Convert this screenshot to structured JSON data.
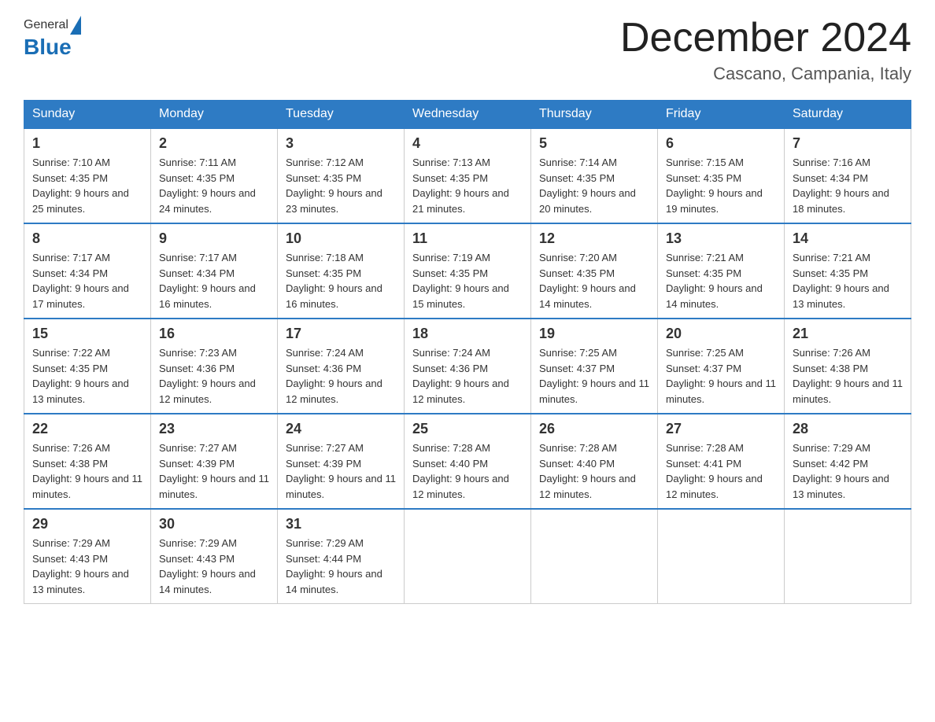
{
  "header": {
    "logo_general": "General",
    "logo_blue": "Blue",
    "month_title": "December 2024",
    "subtitle": "Cascano, Campania, Italy"
  },
  "weekdays": [
    "Sunday",
    "Monday",
    "Tuesday",
    "Wednesday",
    "Thursday",
    "Friday",
    "Saturday"
  ],
  "weeks": [
    [
      {
        "day": "1",
        "sunrise": "Sunrise: 7:10 AM",
        "sunset": "Sunset: 4:35 PM",
        "daylight": "Daylight: 9 hours and 25 minutes."
      },
      {
        "day": "2",
        "sunrise": "Sunrise: 7:11 AM",
        "sunset": "Sunset: 4:35 PM",
        "daylight": "Daylight: 9 hours and 24 minutes."
      },
      {
        "day": "3",
        "sunrise": "Sunrise: 7:12 AM",
        "sunset": "Sunset: 4:35 PM",
        "daylight": "Daylight: 9 hours and 23 minutes."
      },
      {
        "day": "4",
        "sunrise": "Sunrise: 7:13 AM",
        "sunset": "Sunset: 4:35 PM",
        "daylight": "Daylight: 9 hours and 21 minutes."
      },
      {
        "day": "5",
        "sunrise": "Sunrise: 7:14 AM",
        "sunset": "Sunset: 4:35 PM",
        "daylight": "Daylight: 9 hours and 20 minutes."
      },
      {
        "day": "6",
        "sunrise": "Sunrise: 7:15 AM",
        "sunset": "Sunset: 4:35 PM",
        "daylight": "Daylight: 9 hours and 19 minutes."
      },
      {
        "day": "7",
        "sunrise": "Sunrise: 7:16 AM",
        "sunset": "Sunset: 4:34 PM",
        "daylight": "Daylight: 9 hours and 18 minutes."
      }
    ],
    [
      {
        "day": "8",
        "sunrise": "Sunrise: 7:17 AM",
        "sunset": "Sunset: 4:34 PM",
        "daylight": "Daylight: 9 hours and 17 minutes."
      },
      {
        "day": "9",
        "sunrise": "Sunrise: 7:17 AM",
        "sunset": "Sunset: 4:34 PM",
        "daylight": "Daylight: 9 hours and 16 minutes."
      },
      {
        "day": "10",
        "sunrise": "Sunrise: 7:18 AM",
        "sunset": "Sunset: 4:35 PM",
        "daylight": "Daylight: 9 hours and 16 minutes."
      },
      {
        "day": "11",
        "sunrise": "Sunrise: 7:19 AM",
        "sunset": "Sunset: 4:35 PM",
        "daylight": "Daylight: 9 hours and 15 minutes."
      },
      {
        "day": "12",
        "sunrise": "Sunrise: 7:20 AM",
        "sunset": "Sunset: 4:35 PM",
        "daylight": "Daylight: 9 hours and 14 minutes."
      },
      {
        "day": "13",
        "sunrise": "Sunrise: 7:21 AM",
        "sunset": "Sunset: 4:35 PM",
        "daylight": "Daylight: 9 hours and 14 minutes."
      },
      {
        "day": "14",
        "sunrise": "Sunrise: 7:21 AM",
        "sunset": "Sunset: 4:35 PM",
        "daylight": "Daylight: 9 hours and 13 minutes."
      }
    ],
    [
      {
        "day": "15",
        "sunrise": "Sunrise: 7:22 AM",
        "sunset": "Sunset: 4:35 PM",
        "daylight": "Daylight: 9 hours and 13 minutes."
      },
      {
        "day": "16",
        "sunrise": "Sunrise: 7:23 AM",
        "sunset": "Sunset: 4:36 PM",
        "daylight": "Daylight: 9 hours and 12 minutes."
      },
      {
        "day": "17",
        "sunrise": "Sunrise: 7:24 AM",
        "sunset": "Sunset: 4:36 PM",
        "daylight": "Daylight: 9 hours and 12 minutes."
      },
      {
        "day": "18",
        "sunrise": "Sunrise: 7:24 AM",
        "sunset": "Sunset: 4:36 PM",
        "daylight": "Daylight: 9 hours and 12 minutes."
      },
      {
        "day": "19",
        "sunrise": "Sunrise: 7:25 AM",
        "sunset": "Sunset: 4:37 PM",
        "daylight": "Daylight: 9 hours and 11 minutes."
      },
      {
        "day": "20",
        "sunrise": "Sunrise: 7:25 AM",
        "sunset": "Sunset: 4:37 PM",
        "daylight": "Daylight: 9 hours and 11 minutes."
      },
      {
        "day": "21",
        "sunrise": "Sunrise: 7:26 AM",
        "sunset": "Sunset: 4:38 PM",
        "daylight": "Daylight: 9 hours and 11 minutes."
      }
    ],
    [
      {
        "day": "22",
        "sunrise": "Sunrise: 7:26 AM",
        "sunset": "Sunset: 4:38 PM",
        "daylight": "Daylight: 9 hours and 11 minutes."
      },
      {
        "day": "23",
        "sunrise": "Sunrise: 7:27 AM",
        "sunset": "Sunset: 4:39 PM",
        "daylight": "Daylight: 9 hours and 11 minutes."
      },
      {
        "day": "24",
        "sunrise": "Sunrise: 7:27 AM",
        "sunset": "Sunset: 4:39 PM",
        "daylight": "Daylight: 9 hours and 11 minutes."
      },
      {
        "day": "25",
        "sunrise": "Sunrise: 7:28 AM",
        "sunset": "Sunset: 4:40 PM",
        "daylight": "Daylight: 9 hours and 12 minutes."
      },
      {
        "day": "26",
        "sunrise": "Sunrise: 7:28 AM",
        "sunset": "Sunset: 4:40 PM",
        "daylight": "Daylight: 9 hours and 12 minutes."
      },
      {
        "day": "27",
        "sunrise": "Sunrise: 7:28 AM",
        "sunset": "Sunset: 4:41 PM",
        "daylight": "Daylight: 9 hours and 12 minutes."
      },
      {
        "day": "28",
        "sunrise": "Sunrise: 7:29 AM",
        "sunset": "Sunset: 4:42 PM",
        "daylight": "Daylight: 9 hours and 13 minutes."
      }
    ],
    [
      {
        "day": "29",
        "sunrise": "Sunrise: 7:29 AM",
        "sunset": "Sunset: 4:43 PM",
        "daylight": "Daylight: 9 hours and 13 minutes."
      },
      {
        "day": "30",
        "sunrise": "Sunrise: 7:29 AM",
        "sunset": "Sunset: 4:43 PM",
        "daylight": "Daylight: 9 hours and 14 minutes."
      },
      {
        "day": "31",
        "sunrise": "Sunrise: 7:29 AM",
        "sunset": "Sunset: 4:44 PM",
        "daylight": "Daylight: 9 hours and 14 minutes."
      },
      null,
      null,
      null,
      null
    ]
  ]
}
